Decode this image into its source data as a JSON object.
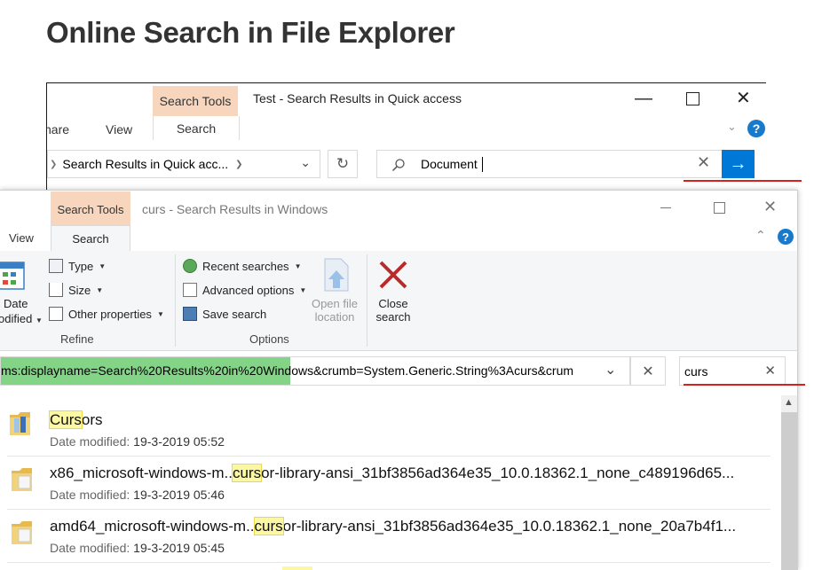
{
  "page": {
    "heading": "Online Search in File Explorer"
  },
  "back_window": {
    "context_tab": "Search Tools",
    "title": "Test - Search Results in Quick access",
    "tabs": [
      "hare",
      "View"
    ],
    "selected_tab": "Search",
    "address": "Search Results in Quick acc...",
    "search_value": "Document"
  },
  "front_window": {
    "context_tab": "Search Tools",
    "title": "curs - Search Results in Windows",
    "tab_view": "View",
    "selected_tab": "Search",
    "refine": {
      "date_modified_line1": "Date",
      "date_modified_line2": "odified",
      "type": "Type",
      "size": "Size",
      "other_properties": "Other properties",
      "group_label": "Refine"
    },
    "options": {
      "recent_searches": "Recent searches",
      "advanced_options": "Advanced options",
      "save_search": "Save search",
      "open_file_location_line1": "Open file",
      "open_file_location_line2": "location",
      "close_search_line1": "Close",
      "close_search_line2": "search",
      "group_label": "Options"
    },
    "address": "ms:displayname=Search%20Results%20in%20Windows&crumb=System.Generic.String%3Acurs&crum",
    "search_value": "curs",
    "results": [
      {
        "pre": "",
        "hl": "Curs",
        "post": "ors",
        "meta_key": "Date modified:",
        "meta_val": "19-3-2019 05:52"
      },
      {
        "pre": "x86_microsoft-windows-m..",
        "hl": "curs",
        "post": "or-library-ansi_31bf3856ad364e35_10.0.18362.1_none_c489196d65...",
        "meta_key": "Date modified:",
        "meta_val": "19-3-2019 05:46"
      },
      {
        "pre": "amd64_microsoft-windows-m..",
        "hl": "curs",
        "post": "or-library-ansi_31bf3856ad364e35_10.0.18362.1_none_20a7b4f1...",
        "meta_key": "Date modified:",
        "meta_val": "19-3-2019 05:45"
      }
    ]
  },
  "colors": {
    "context_tab": "#f8d6bd",
    "accent": "#0078d7",
    "highlight": "#fbf7a2",
    "address_selection": "#84d488",
    "annotation_line": "#d5221c"
  }
}
